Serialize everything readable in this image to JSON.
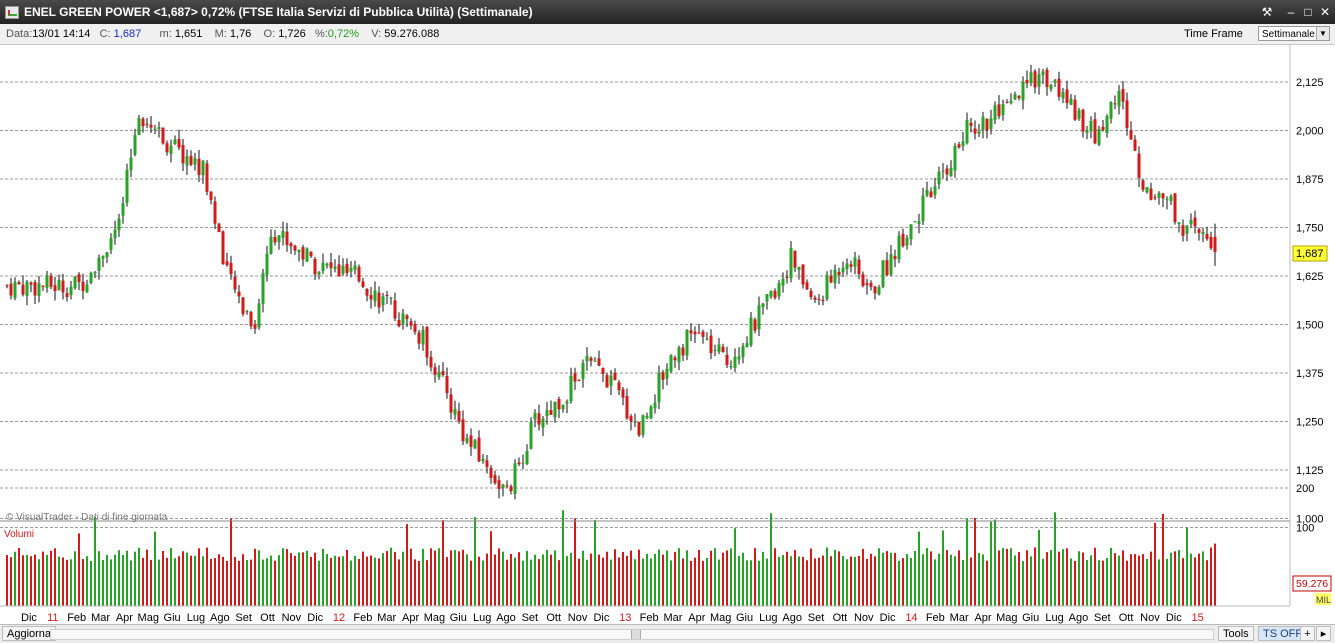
{
  "window": {
    "title": "ENEL GREEN POWER <1,687> 0,72%  (FTSE Italia Servizi di Pubblica Utilità)  (Settimanale)",
    "buttons": [
      "tools-icon",
      "minimize-icon",
      "maximize-icon",
      "close-icon"
    ]
  },
  "info": {
    "data_label": "Data:",
    "data_value": "13/01 14:14",
    "c_label": "C:",
    "c_value": "1,687",
    "m_label": "m:",
    "m_value": "1,651",
    "M_label": "M:",
    "M_value": "1,76",
    "o_label": "O:",
    "o_value": "1,726",
    "pct_label": "%:",
    "pct_value": "0,72%",
    "v_label": "V:",
    "v_value": "59.276.088",
    "timeframe_label": "Time Frame",
    "timeframe_value": "Settimanale"
  },
  "colors": {
    "up": "#27a327",
    "down": "#d11a1a",
    "grid": "#9a9a9a",
    "last_price_bg": "#ffff33",
    "volume_badge": "#c00000"
  },
  "chart": {
    "watermark": "© VisualTrader - Dati di fine giornata",
    "price_label": "1,687",
    "volume_title": "Volumi",
    "volume_value": "59.276",
    "volume_unit": "MIL",
    "y_ticks": [
      "2,125",
      "2,000",
      "1,875",
      "1,750",
      "1,625",
      "1,500",
      "1,375",
      "1,250",
      "1,125",
      "1,000"
    ],
    "vol_ticks": [
      "200",
      "100"
    ],
    "x_labels": [
      "Dic",
      "11",
      "Feb",
      "Mar",
      "Apr",
      "Mag",
      "Giu",
      "Lug",
      "Ago",
      "Set",
      "Ott",
      "Nov",
      "Dic",
      "12",
      "Feb",
      "Mar",
      "Apr",
      "Mag",
      "Giu",
      "Lug",
      "Ago",
      "Set",
      "Ott",
      "Nov",
      "Dic",
      "13",
      "Feb",
      "Mar",
      "Apr",
      "Mag",
      "Giu",
      "Lug",
      "Ago",
      "Set",
      "Ott",
      "Nov",
      "Dic",
      "14",
      "Feb",
      "Mar",
      "Apr",
      "Mag",
      "Giu",
      "Lug",
      "Ago",
      "Set",
      "Ott",
      "Nov",
      "Dic",
      "15"
    ],
    "year_labels": [
      "11",
      "12",
      "13",
      "14",
      "15"
    ]
  },
  "chart_data": {
    "type": "candlestick",
    "title": "ENEL GREEN POWER",
    "timeframe": "weekly",
    "ylim": [
      1.0,
      2.2
    ],
    "volume_ylim": [
      0,
      200
    ],
    "anchors": [
      [
        0,
        1.6
      ],
      [
        18,
        1.6
      ],
      [
        28,
        1.75
      ],
      [
        33,
        2.05
      ],
      [
        42,
        1.95
      ],
      [
        49,
        1.9
      ],
      [
        56,
        1.6
      ],
      [
        62,
        1.5
      ],
      [
        66,
        1.75
      ],
      [
        78,
        1.65
      ],
      [
        88,
        1.62
      ],
      [
        104,
        1.46
      ],
      [
        115,
        1.2
      ],
      [
        121,
        1.12
      ],
      [
        125,
        1.06
      ],
      [
        132,
        1.25
      ],
      [
        138,
        1.3
      ],
      [
        145,
        1.4
      ],
      [
        151,
        1.35
      ],
      [
        158,
        1.23
      ],
      [
        166,
        1.42
      ],
      [
        172,
        1.48
      ],
      [
        180,
        1.4
      ],
      [
        190,
        1.55
      ],
      [
        196,
        1.67
      ],
      [
        202,
        1.55
      ],
      [
        210,
        1.68
      ],
      [
        216,
        1.58
      ],
      [
        224,
        1.73
      ],
      [
        232,
        1.85
      ],
      [
        240,
        2.0
      ],
      [
        250,
        2.05
      ],
      [
        258,
        2.15
      ],
      [
        266,
        2.07
      ],
      [
        272,
        1.98
      ],
      [
        278,
        2.1
      ],
      [
        284,
        1.85
      ],
      [
        290,
        1.83
      ],
      [
        294,
        1.75
      ],
      [
        300,
        1.72
      ],
      [
        302,
        1.7
      ]
    ],
    "last_candle": {
      "open": 1.726,
      "high": 1.76,
      "low": 1.651,
      "close": 1.687,
      "change_pct": 0.72,
      "volume": 59276088
    },
    "grid": true
  }
}
